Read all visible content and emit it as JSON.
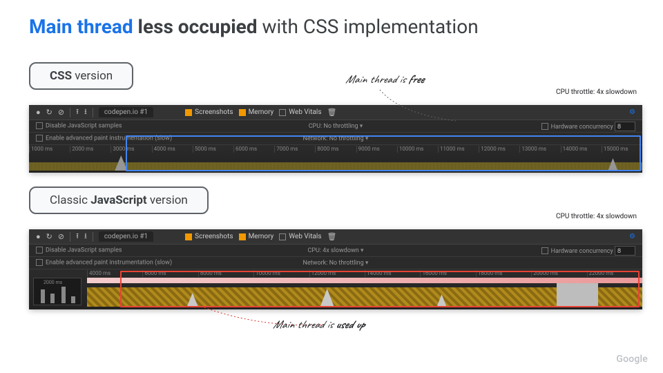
{
  "title": {
    "blue": "Main thread",
    "bold": " less occupied",
    "rest": " with CSS implementation"
  },
  "labels": {
    "css_pill_prefix": "CSS",
    "css_pill_rest": " version",
    "js_pill_prefix": "Classic ",
    "js_pill_bold": "JavaScript",
    "js_pill_rest": " version",
    "throttle": "CPU throttle: 4x slowdown"
  },
  "annotations": {
    "free_pre": "Main thread is ",
    "free_b": "free",
    "used_pre": "Main thread is ",
    "used_b": "used up"
  },
  "devtools_css": {
    "tab": "codepen.io #1",
    "checks": {
      "screenshots": "Screenshots",
      "memory": "Memory",
      "webvitals": "Web Vitals"
    },
    "row1_left": "Disable JavaScript samples",
    "row1_mid_label": "CPU:",
    "row1_mid_val": "No throttling",
    "row1_right_label": "Hardware concurrency",
    "row1_right_val": "8",
    "row2_left": "Enable advanced paint instrumentation (slow)",
    "row2_mid_label": "Network:",
    "row2_mid_val": "No throttling",
    "ticks": [
      "1000 ms",
      "2000 ms",
      "3000 ms",
      "4000 ms",
      "5000 ms",
      "6000 ms",
      "7000 ms",
      "8000 ms",
      "9000 ms",
      "10000 ms",
      "11000 ms",
      "12000 ms",
      "13000 ms",
      "14000 ms",
      "15000 ms"
    ]
  },
  "devtools_js": {
    "tab": "codepen.io #1",
    "checks": {
      "screenshots": "Screenshots",
      "memory": "Memory",
      "webvitals": "Web Vitals"
    },
    "row1_left": "Disable JavaScript samples",
    "row1_mid_label": "CPU:",
    "row1_mid_val": "4x slowdown",
    "row1_right_label": "Hardware concurrency",
    "row1_right_val": "8",
    "row2_left": "Enable advanced paint instrumentation (slow)",
    "row2_mid_label": "Network:",
    "row2_mid_val": "No throttling",
    "mini_tick": "2000 ms",
    "ticks": [
      "4000 ms",
      "6000 ms",
      "8000 ms",
      "10000 ms",
      "12000 ms",
      "14000 ms",
      "16000 ms",
      "18000 ms",
      "20000 ms",
      "22000 ms"
    ]
  },
  "logo": "Google"
}
